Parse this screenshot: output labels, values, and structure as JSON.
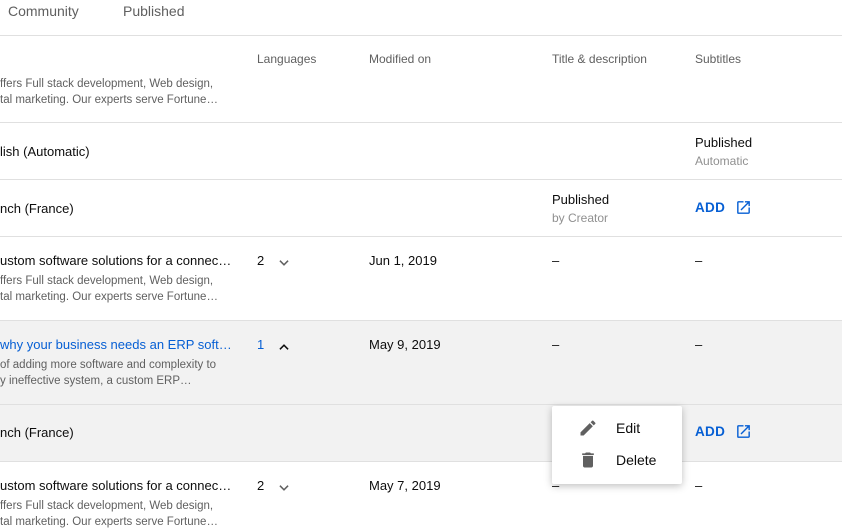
{
  "tabs": [
    {
      "label": "Community"
    },
    {
      "label": "Published"
    }
  ],
  "columns": {
    "languages": "Languages",
    "modified_on": "Modified on",
    "title_description": "Title & description",
    "subtitles": "Subtitles"
  },
  "rows": [
    {
      "desc_line1": "ffers Full stack development, Web design,",
      "desc_line2": "tal marketing. Our experts serve Fortune…"
    },
    {
      "title": "lish (Automatic)",
      "subtitles_status": "Published",
      "subtitles_sub": "Automatic"
    },
    {
      "title": "nch (France)",
      "td_status": "Published",
      "td_sub": "by Creator",
      "add_label": "ADD"
    },
    {
      "title": "ustom software solutions for a connec…",
      "desc_line1": "ffers Full stack development, Web design,",
      "desc_line2": "tal marketing. Our experts serve Fortune…",
      "languages": "2",
      "modified": "Jun 1, 2019",
      "title_desc": "–",
      "subtitles": "–"
    },
    {
      "title": "why your business needs an ERP soft…",
      "desc_line1": "of adding more software and complexity to",
      "desc_line2": "y ineffective system, a custom ERP…",
      "languages": "1",
      "modified": "May 9, 2019",
      "title_desc": "–",
      "subtitles": "–"
    },
    {
      "title": "nch (France)",
      "add_label": "ADD"
    },
    {
      "title": "ustom software solutions for a connec…",
      "desc_line1": "ffers Full stack development, Web design,",
      "desc_line2": "tal marketing. Our experts serve Fortune…",
      "languages": "2",
      "modified": "May 7, 2019",
      "title_desc": "–",
      "subtitles": "–"
    }
  ],
  "menu": {
    "edit_label": "Edit",
    "delete_label": "Delete"
  },
  "colors": {
    "accent": "#065fd4",
    "row_highlight": "#f2f2f2",
    "divider": "#e0e0e0"
  },
  "icons": [
    "chevron-down-icon",
    "chevron-up-icon",
    "external-link-icon",
    "pencil-icon",
    "trash-icon"
  ]
}
